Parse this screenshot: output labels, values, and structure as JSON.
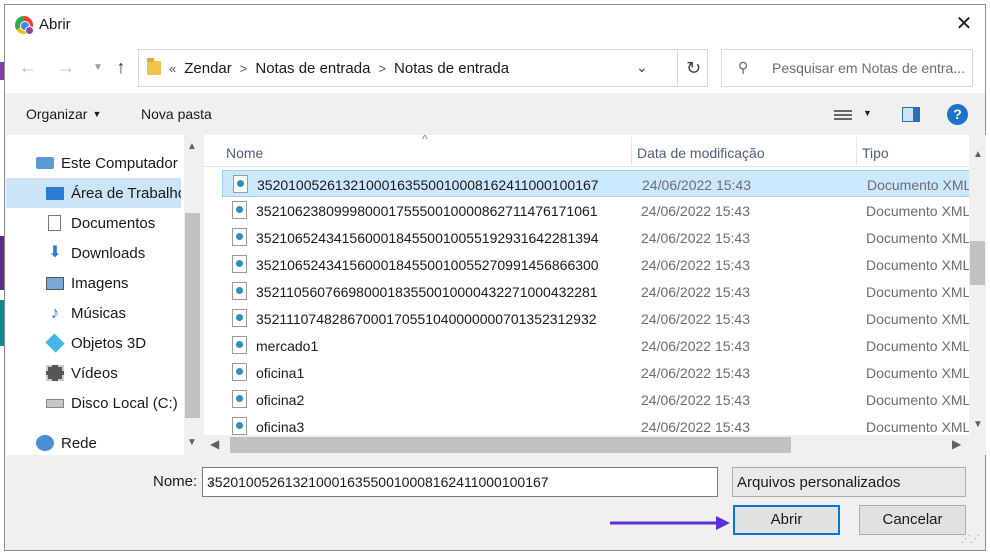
{
  "window": {
    "title": "Abrir",
    "app_icon": "chrome-icon"
  },
  "navigation": {
    "back_icon": "arrow-left-icon",
    "forward_icon": "arrow-right-icon",
    "recent_icon": "chevron-down-icon",
    "up_icon": "arrow-up-icon",
    "breadcrumb_prefix": "«",
    "breadcrumbs": [
      "Zendar",
      "Notas de entrada",
      "Notas de entrada"
    ],
    "refresh_icon": "refresh-icon",
    "search_placeholder": "Pesquisar em Notas de entra..."
  },
  "toolbar": {
    "organize_label": "Organizar",
    "new_folder_label": "Nova pasta",
    "help_label": "?"
  },
  "sidebar": {
    "items": [
      {
        "label": "Este Computador",
        "icon": "computer-icon",
        "selected": false
      },
      {
        "label": "Área de Trabalho",
        "icon": "desktop-icon",
        "selected": true
      },
      {
        "label": "Documentos",
        "icon": "documents-icon",
        "selected": false
      },
      {
        "label": "Downloads",
        "icon": "download-icon",
        "selected": false
      },
      {
        "label": "Imagens",
        "icon": "images-icon",
        "selected": false
      },
      {
        "label": "Músicas",
        "icon": "music-icon",
        "selected": false
      },
      {
        "label": "Objetos 3D",
        "icon": "3d-objects-icon",
        "selected": false
      },
      {
        "label": "Vídeos",
        "icon": "videos-icon",
        "selected": false
      },
      {
        "label": "Disco Local (C:)",
        "icon": "disk-icon",
        "selected": false
      },
      {
        "label": "Rede",
        "icon": "network-icon",
        "selected": false
      }
    ]
  },
  "file_list": {
    "columns": {
      "name": "Nome",
      "date": "Data de modificação",
      "type": "Tipo"
    },
    "rows": [
      {
        "name": "35201005261321000163550010008162411000100167",
        "date": "24/06/2022 15:43",
        "type": "Documento XML",
        "selected": true
      },
      {
        "name": "35210623809998000175550010000862711476171061",
        "date": "24/06/2022 15:43",
        "type": "Documento XML",
        "selected": false
      },
      {
        "name": "35210652434156000184550010055192931642281394",
        "date": "24/06/2022 15:43",
        "type": "Documento XML",
        "selected": false
      },
      {
        "name": "35210652434156000184550010055270991456866300",
        "date": "24/06/2022 15:43",
        "type": "Documento XML",
        "selected": false
      },
      {
        "name": "35211056076698000183550010000432271000432281",
        "date": "24/06/2022 15:43",
        "type": "Documento XML",
        "selected": false
      },
      {
        "name": "35211107482867000170551040000000701352312932",
        "date": "24/06/2022 15:43",
        "type": "Documento XML",
        "selected": false
      },
      {
        "name": "mercado1",
        "date": "24/06/2022 15:43",
        "type": "Documento XML",
        "selected": false
      },
      {
        "name": "oficina1",
        "date": "24/06/2022 15:43",
        "type": "Documento XML",
        "selected": false
      },
      {
        "name": "oficina2",
        "date": "24/06/2022 15:43",
        "type": "Documento XML",
        "selected": false
      },
      {
        "name": "oficina3",
        "date": "24/06/2022 15:43",
        "type": "Documento XML",
        "selected": false
      }
    ]
  },
  "footer": {
    "name_label": "Nome:",
    "name_value": "35201005261321000163550010008162411000100167",
    "filetype_value": "Arquivos personalizados",
    "open_label": "Abrir",
    "cancel_label": "Cancelar"
  },
  "colors": {
    "annotation_arrow": "#5b2fd9",
    "selection": "#cce8ff",
    "accent": "#0078d7"
  }
}
